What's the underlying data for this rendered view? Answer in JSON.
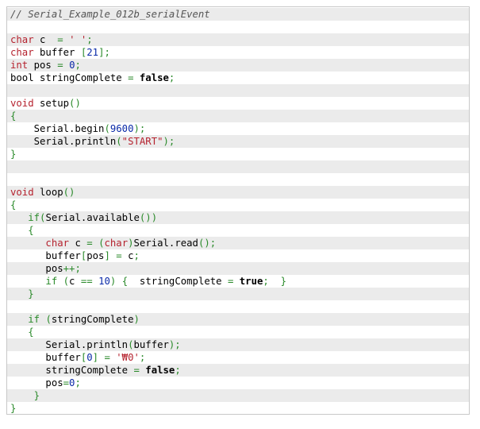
{
  "code": {
    "lines": [
      [
        {
          "t": "// Serial_Example_012b_serialEvent",
          "c": "comment"
        }
      ],
      [],
      [
        {
          "t": "char",
          "c": "type"
        },
        {
          "t": " c  ",
          "c": "id"
        },
        {
          "t": "=",
          "c": "op"
        },
        {
          "t": " ",
          "c": "id"
        },
        {
          "t": "' '",
          "c": "str"
        },
        {
          "t": ";",
          "c": "op"
        }
      ],
      [
        {
          "t": "char",
          "c": "type"
        },
        {
          "t": " buffer ",
          "c": "id"
        },
        {
          "t": "[",
          "c": "op"
        },
        {
          "t": "21",
          "c": "num"
        },
        {
          "t": "];",
          "c": "op"
        }
      ],
      [
        {
          "t": "int",
          "c": "type"
        },
        {
          "t": " pos ",
          "c": "id"
        },
        {
          "t": "=",
          "c": "op"
        },
        {
          "t": " ",
          "c": "id"
        },
        {
          "t": "0",
          "c": "num"
        },
        {
          "t": ";",
          "c": "op"
        }
      ],
      [
        {
          "t": "bool stringComplete ",
          "c": "id"
        },
        {
          "t": "=",
          "c": "op"
        },
        {
          "t": " ",
          "c": "id"
        },
        {
          "t": "false",
          "c": "bool"
        },
        {
          "t": ";",
          "c": "op"
        }
      ],
      [],
      [
        {
          "t": "void",
          "c": "type"
        },
        {
          "t": " setup",
          "c": "id"
        },
        {
          "t": "()",
          "c": "op"
        }
      ],
      [
        {
          "t": "{",
          "c": "op"
        }
      ],
      [
        {
          "t": "    Serial.begin",
          "c": "id"
        },
        {
          "t": "(",
          "c": "op"
        },
        {
          "t": "9600",
          "c": "num"
        },
        {
          "t": ");",
          "c": "op"
        }
      ],
      [
        {
          "t": "    Serial.println",
          "c": "id"
        },
        {
          "t": "(",
          "c": "op"
        },
        {
          "t": "\"START\"",
          "c": "str"
        },
        {
          "t": ");",
          "c": "op"
        }
      ],
      [
        {
          "t": "}",
          "c": "op"
        }
      ],
      [],
      [],
      [
        {
          "t": "void",
          "c": "type"
        },
        {
          "t": " loop",
          "c": "id"
        },
        {
          "t": "()",
          "c": "op"
        }
      ],
      [
        {
          "t": "{",
          "c": "op"
        }
      ],
      [
        {
          "t": "   ",
          "c": "id"
        },
        {
          "t": "if",
          "c": "kw"
        },
        {
          "t": "(",
          "c": "op"
        },
        {
          "t": "Serial.available",
          "c": "id"
        },
        {
          "t": "())",
          "c": "op"
        }
      ],
      [
        {
          "t": "   ",
          "c": "id"
        },
        {
          "t": "{",
          "c": "op"
        }
      ],
      [
        {
          "t": "      ",
          "c": "id"
        },
        {
          "t": "char",
          "c": "type"
        },
        {
          "t": " c ",
          "c": "id"
        },
        {
          "t": "=",
          "c": "op"
        },
        {
          "t": " ",
          "c": "id"
        },
        {
          "t": "(",
          "c": "op"
        },
        {
          "t": "char",
          "c": "type"
        },
        {
          "t": ")",
          "c": "op"
        },
        {
          "t": "Serial.read",
          "c": "id"
        },
        {
          "t": "();",
          "c": "op"
        }
      ],
      [
        {
          "t": "      buffer",
          "c": "id"
        },
        {
          "t": "[",
          "c": "op"
        },
        {
          "t": "pos",
          "c": "id"
        },
        {
          "t": "]",
          "c": "op"
        },
        {
          "t": " ",
          "c": "id"
        },
        {
          "t": "=",
          "c": "op"
        },
        {
          "t": " c",
          "c": "id"
        },
        {
          "t": ";",
          "c": "op"
        }
      ],
      [
        {
          "t": "      pos",
          "c": "id"
        },
        {
          "t": "++;",
          "c": "op"
        }
      ],
      [
        {
          "t": "      ",
          "c": "id"
        },
        {
          "t": "if",
          "c": "kw"
        },
        {
          "t": " ",
          "c": "id"
        },
        {
          "t": "(",
          "c": "op"
        },
        {
          "t": "c ",
          "c": "id"
        },
        {
          "t": "==",
          "c": "op"
        },
        {
          "t": " ",
          "c": "id"
        },
        {
          "t": "10",
          "c": "num"
        },
        {
          "t": ")",
          "c": "op"
        },
        {
          "t": " ",
          "c": "id"
        },
        {
          "t": "{",
          "c": "op"
        },
        {
          "t": "  stringComplete ",
          "c": "id"
        },
        {
          "t": "=",
          "c": "op"
        },
        {
          "t": " ",
          "c": "id"
        },
        {
          "t": "true",
          "c": "bool"
        },
        {
          "t": ";",
          "c": "op"
        },
        {
          "t": "  ",
          "c": "id"
        },
        {
          "t": "}",
          "c": "op"
        }
      ],
      [
        {
          "t": "   ",
          "c": "id"
        },
        {
          "t": "}",
          "c": "op"
        }
      ],
      [],
      [
        {
          "t": "   ",
          "c": "id"
        },
        {
          "t": "if",
          "c": "kw"
        },
        {
          "t": " ",
          "c": "id"
        },
        {
          "t": "(",
          "c": "op"
        },
        {
          "t": "stringComplete",
          "c": "id"
        },
        {
          "t": ")",
          "c": "op"
        }
      ],
      [
        {
          "t": "   ",
          "c": "id"
        },
        {
          "t": "{",
          "c": "op"
        }
      ],
      [
        {
          "t": "      Serial.println",
          "c": "id"
        },
        {
          "t": "(",
          "c": "op"
        },
        {
          "t": "buffer",
          "c": "id"
        },
        {
          "t": ");",
          "c": "op"
        }
      ],
      [
        {
          "t": "      buffer",
          "c": "id"
        },
        {
          "t": "[",
          "c": "op"
        },
        {
          "t": "0",
          "c": "num"
        },
        {
          "t": "]",
          "c": "op"
        },
        {
          "t": " ",
          "c": "id"
        },
        {
          "t": "=",
          "c": "op"
        },
        {
          "t": " ",
          "c": "id"
        },
        {
          "t": "'₩0'",
          "c": "str"
        },
        {
          "t": ";",
          "c": "op"
        }
      ],
      [
        {
          "t": "      stringComplete ",
          "c": "id"
        },
        {
          "t": "=",
          "c": "op"
        },
        {
          "t": " ",
          "c": "id"
        },
        {
          "t": "false",
          "c": "bool"
        },
        {
          "t": ";",
          "c": "op"
        }
      ],
      [
        {
          "t": "      pos",
          "c": "id"
        },
        {
          "t": "=",
          "c": "op"
        },
        {
          "t": "0",
          "c": "num"
        },
        {
          "t": ";",
          "c": "op"
        }
      ],
      [
        {
          "t": "    ",
          "c": "id"
        },
        {
          "t": "}",
          "c": "op"
        }
      ],
      [
        {
          "t": "}",
          "c": "op"
        }
      ]
    ]
  },
  "colors": {
    "comment": "#555555",
    "type": "#b5222e",
    "number": "#0a2aa8",
    "string": "#b5222e",
    "operator": "#2a8a2a",
    "keyword": "#2a8a2a",
    "stripe_odd": "#ebebeb",
    "stripe_even": "#ffffff"
  }
}
